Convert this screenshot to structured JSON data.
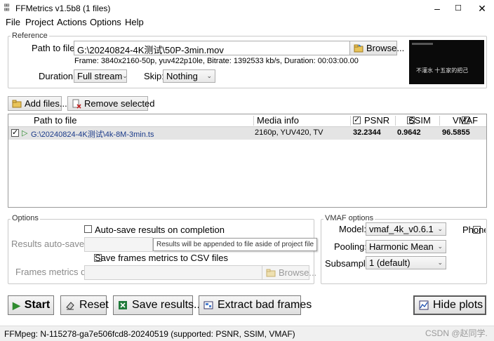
{
  "window": {
    "title": "FFMetrics v1.5b8 (1 files)",
    "minimize": "–",
    "maximize": "☐",
    "close": "✕"
  },
  "menu": [
    "File",
    "Project",
    "Actions",
    "Options",
    "Help"
  ],
  "reference": {
    "legend": "Reference",
    "path_label": "Path to file:",
    "path_value": "G:\\20240824-4K测试\\50P-3min.mov",
    "browse_label": "Browse...",
    "frame_info": "Frame: 3840x2160-50p, yuv422p10le, Bitrate: 1392533 kb/s, Duration: 00:03:00.00",
    "duration_label": "Duration:",
    "duration_value": "Full stream",
    "skip_label": "Skip:",
    "skip_value": "Nothing",
    "thumbnail_caption": "不灌水 十五家的把己"
  },
  "toolbar": {
    "add_files": "Add files...",
    "remove_selected": "Remove selected"
  },
  "grid": {
    "headers": {
      "path": "Path to file",
      "media": "Media info",
      "psnr": "PSNR",
      "ssim": "SSIM",
      "vmaf": "VMAF"
    },
    "header_checks": {
      "psnr": true,
      "ssim": true,
      "vmaf": true
    },
    "rows": [
      {
        "checked": true,
        "path": "G:\\20240824-4K测试\\4k-8M-3min.ts",
        "media": "2160p, YUV420, TV",
        "psnr": "32.2344",
        "ssim": "0.9642",
        "vmaf": "96.5855"
      }
    ]
  },
  "options": {
    "legend": "Options",
    "auto_save_label": "Auto-save results on completion",
    "auto_save_checked": false,
    "results_folder_label": "Results auto-save fil",
    "tooltip": "Results will be appended to file aside of project file",
    "save_frames_label": "Save frames metrics to CSV files",
    "save_frames_checked": false,
    "frames_dir_label": "Frames metrics dir:",
    "frames_browse": "Browse..."
  },
  "vmaf_options": {
    "legend": "VMAF options",
    "model_label": "Model:",
    "model_value": "vmaf_4k_v0.6.1",
    "phone_label": "Phone",
    "phone_checked": false,
    "pooling_label": "Pooling:",
    "pooling_value": "Harmonic Mean",
    "subsample_label": "Subsample",
    "subsample_value": "1 (default)"
  },
  "actions": {
    "start": "Start",
    "reset": "Reset",
    "save_results": "Save results...",
    "extract_bad": "Extract bad frames",
    "hide_plots": "Hide plots"
  },
  "status": {
    "ffmpeg": "FFMpeg: N-115278-ga7e506fcd8-20240519 (supported: PSNR, SSIM, VMAF)",
    "watermark": "CSDN @赵同学."
  },
  "colors": {
    "play_green": "#2e8b2e",
    "path_blue": "#1a3a8a",
    "selected_row": "#e4e4e4"
  }
}
